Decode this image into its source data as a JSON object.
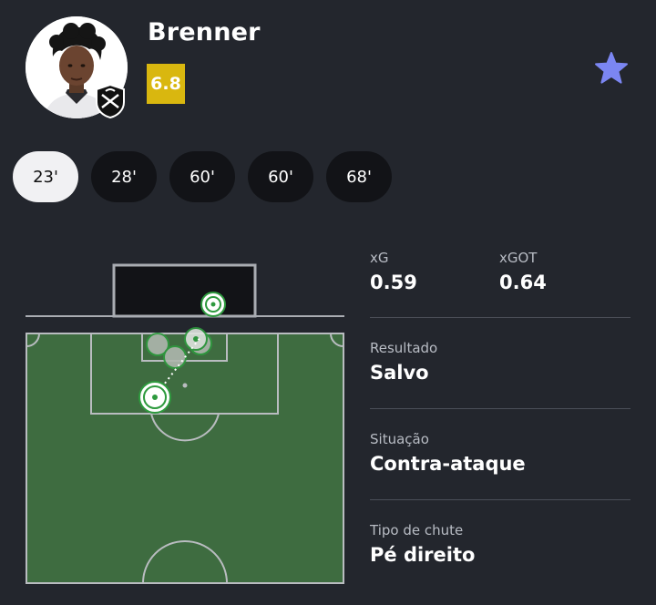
{
  "player": {
    "name": "Brenner",
    "rating": "6.8"
  },
  "favorite_icon": "star-icon",
  "colors": {
    "background": "#23262d",
    "rating_badge": "#d9b70f",
    "star": "#7b86f2",
    "pitch": "#3e6c40",
    "shot_marker": "#2e9a3e"
  },
  "shots": [
    {
      "label": "23'",
      "active": true
    },
    {
      "label": "28'",
      "active": false
    },
    {
      "label": "60'",
      "active": false
    },
    {
      "label": "60'",
      "active": false
    },
    {
      "label": "68'",
      "active": false
    }
  ],
  "stats": {
    "xg_label": "xG",
    "xg_value": "0.59",
    "xgot_label": "xGOT",
    "xgot_value": "0.64",
    "result_label": "Resultado",
    "result_value": "Salvo",
    "situation_label": "Situação",
    "situation_value": "Contra-ataque",
    "shot_type_label": "Tipo de chute",
    "shot_type_value": "Pé direito"
  }
}
